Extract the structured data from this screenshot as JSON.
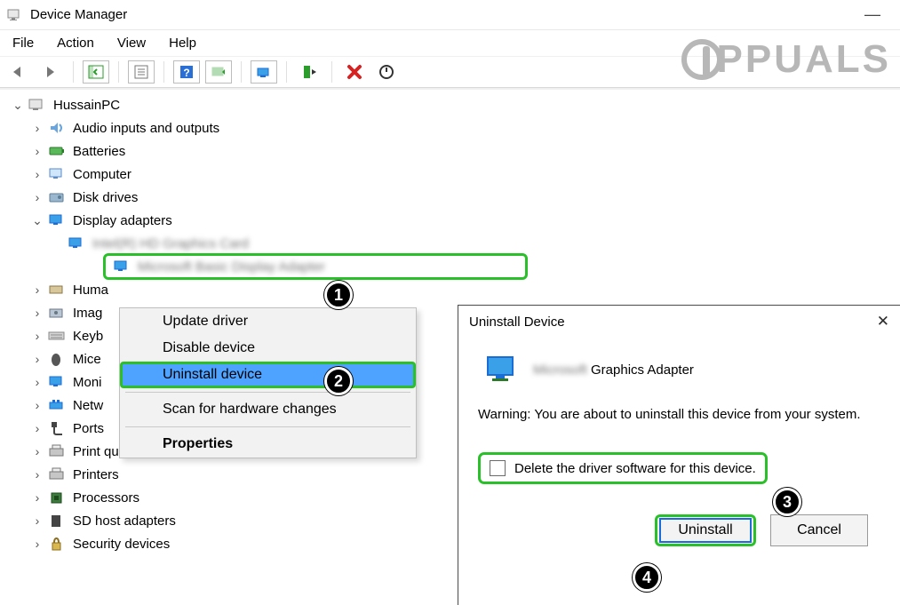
{
  "window": {
    "title": "Device Manager"
  },
  "menus": {
    "file": "File",
    "action": "Action",
    "view": "View",
    "help": "Help"
  },
  "tree": {
    "root": "HussainPC",
    "items": [
      "Audio inputs and outputs",
      "Batteries",
      "Computer",
      "Disk drives",
      "Display adapters",
      "Human Interface Devices",
      "Imaging devices",
      "Keyboards",
      "Mice and other pointing devices",
      "Monitors",
      "Network adapters",
      "Ports (COM & LPT)",
      "Print queues",
      "Printers",
      "Processors",
      "SD host adapters",
      "Security devices"
    ],
    "truncated": {
      "5": "Huma",
      "6": "Imag",
      "7": "Keyb",
      "8": "Mice",
      "9": "Moni",
      "10": "Netw",
      "11": "Ports"
    },
    "display_child_blur1": "Intel(R) HD Graphics Card",
    "display_child_blur2": "Microsoft Basic Display Adapter"
  },
  "context_menu": {
    "update": "Update driver",
    "disable": "Disable device",
    "uninstall": "Uninstall device",
    "scan": "Scan for hardware changes",
    "properties": "Properties"
  },
  "dialog": {
    "title": "Uninstall Device",
    "device_suffix": "Graphics Adapter",
    "device_blur": "Microsoft",
    "warning": "Warning: You are about to uninstall this device from your system.",
    "delete_label": "Delete the driver software for this device.",
    "ok": "Uninstall",
    "cancel": "Cancel"
  },
  "markers": {
    "1": "1",
    "2": "2",
    "3": "3",
    "4": "4"
  },
  "watermark": "PPUALS"
}
